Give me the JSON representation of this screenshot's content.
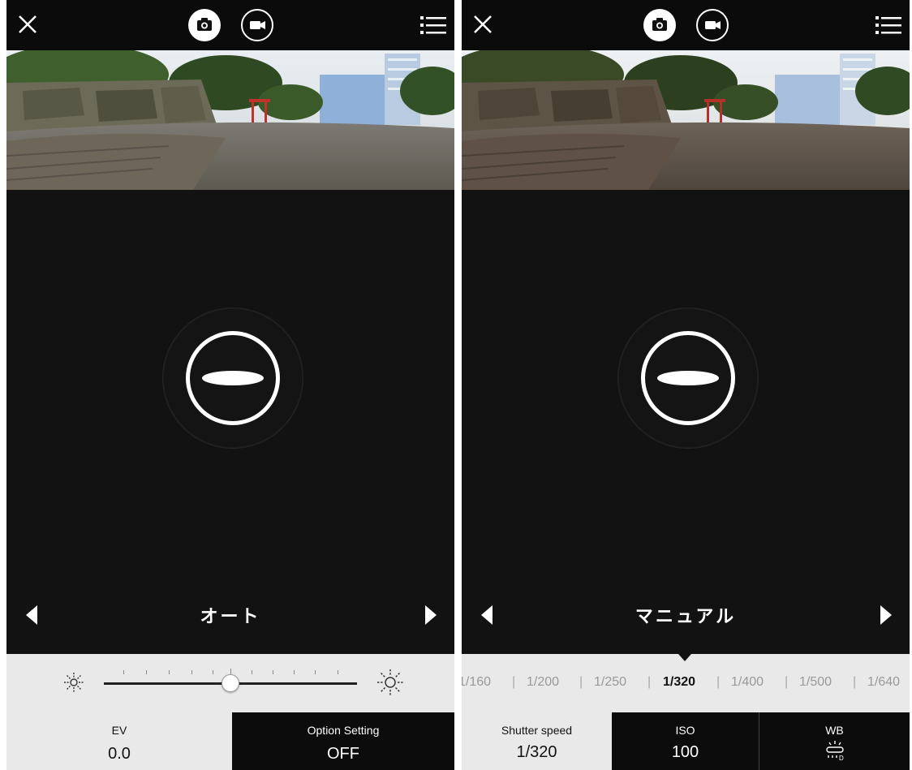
{
  "colors": {
    "bar": "#0b0b0b",
    "dark": "#121212",
    "panel": "#e9e9e9",
    "accent": "#ffffff"
  },
  "icons": {
    "close": "close-icon",
    "photo_mode": "camera-icon",
    "video_mode": "video-camera-icon",
    "menu": "menu-list-icon",
    "prev": "triangle-left-icon",
    "next": "triangle-right-icon",
    "ev_low": "sun-dim-icon",
    "ev_high": "sun-bright-icon",
    "white_balance": "white-balance-icon"
  },
  "auto_screen": {
    "mode_label": "オート",
    "ev": {
      "label": "EV",
      "value": "0.0",
      "slider_level": 0.5
    },
    "option": {
      "label": "Option Setting",
      "value": "OFF"
    }
  },
  "manual_screen": {
    "mode_label": "マニュアル",
    "shutter_speeds": [
      "1/160",
      "1/200",
      "1/250",
      "1/320",
      "1/400",
      "1/500",
      "1/640"
    ],
    "selected_speed": "1/320",
    "shutter": {
      "label": "Shutter speed",
      "value": "1/320"
    },
    "iso": {
      "label": "ISO",
      "value": "100"
    },
    "wb": {
      "label": "WB"
    }
  }
}
